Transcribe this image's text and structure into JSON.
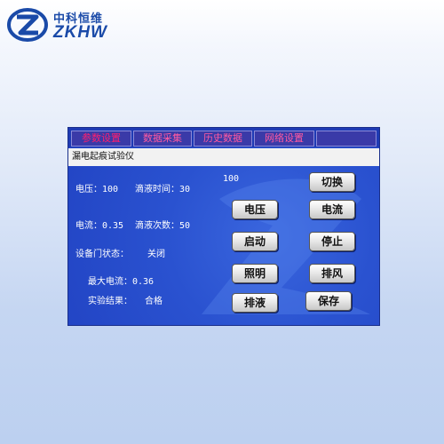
{
  "brand": {
    "name_cn": "中科恒维",
    "name_en": "ZKHW"
  },
  "tabs": [
    {
      "label": "参数设置"
    },
    {
      "label": "数据采集"
    },
    {
      "label": "历史数据"
    },
    {
      "label": "网络设置"
    },
    {
      "label": ""
    }
  ],
  "panel": {
    "title": "漏电起痕试验仪",
    "display_value": "100",
    "fields": {
      "voltage": "电压：100",
      "drip_time": "滴液时间：30",
      "current": "电流：0.35",
      "drip_count": "滴液次数：50",
      "door_status_label": "设备门状态：",
      "door_status_value": "关闭",
      "max_current": "最大电流：0.36",
      "result_label": "实验结果：",
      "result_value": "合格"
    },
    "buttons": {
      "switch": "切换",
      "voltage": "电压",
      "current": "电流",
      "start": "启动",
      "stop": "停止",
      "lighting": "照明",
      "exhaust": "排风",
      "drain": "排液",
      "save": "保存"
    }
  },
  "colors": {
    "screen_bg": "#2448c8",
    "tab_active": "#ff1e6e",
    "logo": "#1a4aa8"
  }
}
